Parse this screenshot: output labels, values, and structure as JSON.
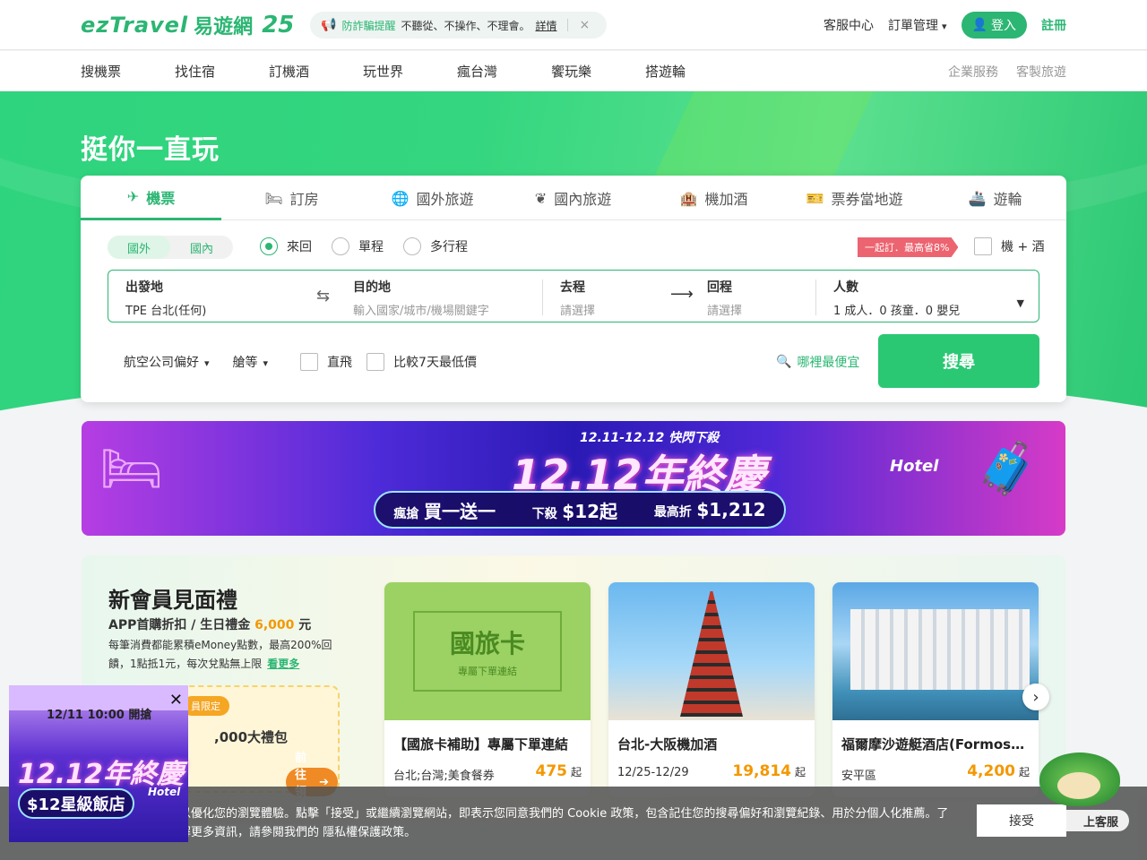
{
  "header": {
    "brand": "ezTravel",
    "brand_cn": "易遊網",
    "anniversary": "25",
    "alert": {
      "label": "防詐騙提醒",
      "message": "不聽從、不操作、不理會。",
      "detail": "詳情",
      "close": "×"
    },
    "links": {
      "service": "客服中心",
      "orders": "訂單管理",
      "login": "登入",
      "register": "註冊"
    }
  },
  "nav": {
    "items": [
      "搜機票",
      "找住宿",
      "訂機酒",
      "玩世界",
      "瘋台灣",
      "饗玩樂",
      "搭遊輪"
    ],
    "secondary": [
      "企業服務",
      "客製旅遊"
    ]
  },
  "hero": {
    "title": "挺你一直玩"
  },
  "search": {
    "tabs": [
      {
        "label": "機票",
        "icon": "plane-icon",
        "glyph": "✈"
      },
      {
        "label": "訂房",
        "icon": "bed-icon",
        "glyph": "🛏"
      },
      {
        "label": "國外旅遊",
        "icon": "globe-icon",
        "glyph": "🌐"
      },
      {
        "label": "國內旅遊",
        "icon": "leaf-icon",
        "glyph": "❦"
      },
      {
        "label": "機加酒",
        "icon": "building-icon",
        "glyph": "🏨"
      },
      {
        "label": "票券當地遊",
        "icon": "ticket-icon",
        "glyph": "🎫"
      },
      {
        "label": "遊輪",
        "icon": "ship-icon",
        "glyph": "🚢"
      }
    ],
    "region": [
      "國外",
      "國內"
    ],
    "trip_types": [
      "來回",
      "單程",
      "多行程"
    ],
    "promo_tag": "一起訂．最高省8%",
    "combo_label": "機 + 酒",
    "from": {
      "label": "出發地",
      "value": "TPE 台北(任何)"
    },
    "to": {
      "label": "目的地",
      "placeholder": "輸入國家/城市/機場關鍵字"
    },
    "depart": {
      "label": "去程",
      "placeholder": "請選擇"
    },
    "return": {
      "label": "回程",
      "placeholder": "請選擇"
    },
    "pax": {
      "label": "人數",
      "value": "1 成人．0 孩童．0 嬰兒"
    },
    "airline_pref": "航空公司偏好",
    "cabin": "艙等",
    "direct": "直飛",
    "compare": "比較7天最低價",
    "cheapest": "哪裡最便宜",
    "button": "搜尋"
  },
  "banner": {
    "subtitle": "12.11-12.12 快閃下殺",
    "title": "12.12年終慶",
    "offer1_a": "瘋搶",
    "offer1_b": "買一送一",
    "offer2_a": "下殺",
    "offer2_b": "$12起",
    "offer3_a": "最高折",
    "offer3_b": "$1,212",
    "hotel": "Hotel"
  },
  "member": {
    "title": "新會員見面禮",
    "line1_a": "APP首購折扣 / 生日禮金",
    "line1_amount": "6,000",
    "line1_b": "元",
    "desc": "每筆消費都能累積eMoney點數，最高200%回饋，1點抵1元，每次兌點無上限",
    "more": "看更多",
    "voucher_badge": "員限定",
    "voucher_text": ",000大禮包",
    "voucher_btn": "前往領取"
  },
  "cards": [
    {
      "title": "【國旅卡補助】專屬下單連結",
      "sub": "台北;台灣;美食餐券",
      "price": "475",
      "qi": "起",
      "img_big": "國旅卡",
      "img_small": "專屬下單連結"
    },
    {
      "title": "台北-大阪機加酒",
      "sub": "12/25-12/29",
      "price": "19,814",
      "qi": "起"
    },
    {
      "title": "福爾摩沙遊艇酒店(Formosa ...",
      "sub": "安平區",
      "price": "4,200",
      "qi": "起"
    }
  ],
  "cookie": {
    "text": "以優化您的瀏覽體驗。點擊「接受」或繼續瀏覽網站，即表示您同意我們的 Cookie 政策，包含記住您的搜尋偏好和瀏覽紀錄、用於分個人化推薦。了解更多資訊，請參閱我們的 隱私權保護政策。",
    "accept": "接受"
  },
  "popup": {
    "date": "12/11 10:00 開搶",
    "close": "✕",
    "title": "12.12年終慶",
    "offer": "$12星級飯店",
    "hotel": "Hotel"
  },
  "chat": {
    "label": "上客服"
  }
}
